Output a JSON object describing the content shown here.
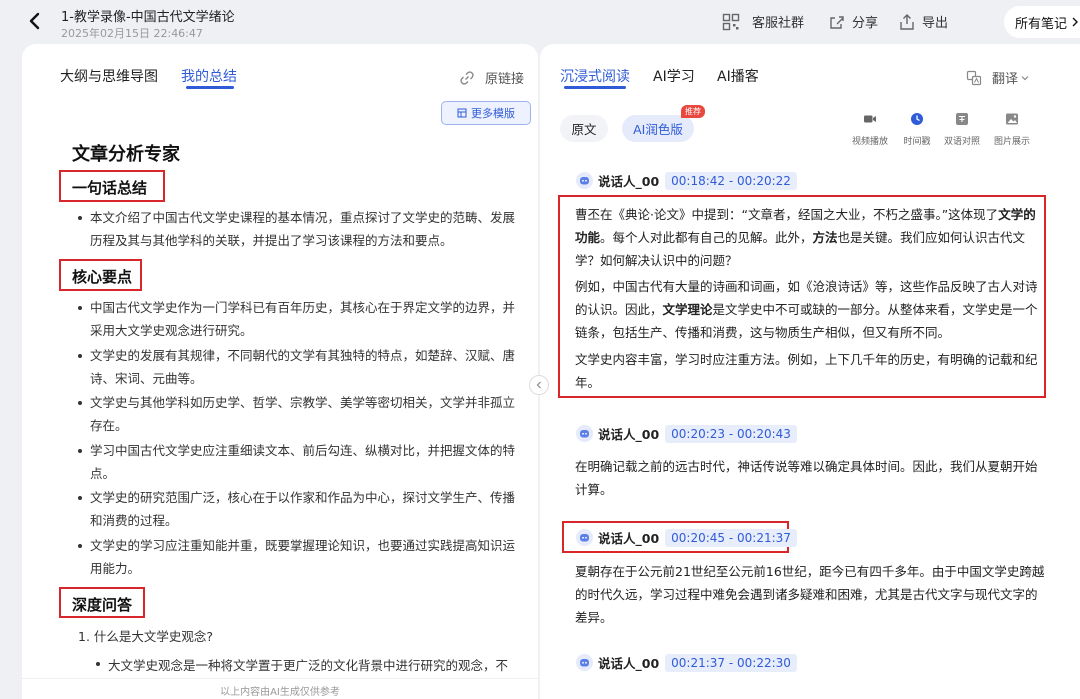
{
  "header": {
    "title": "1-教学录像-中国古代文学绪论",
    "subtitle": "2025年02月15日 22:46:47",
    "community_label": "客服社群",
    "share_label": "分享",
    "export_label": "导出",
    "all_notes_label": "所有笔记"
  },
  "left": {
    "tabs": [
      "大纲与思维导图",
      "我的总结"
    ],
    "active_tab": 1,
    "original_link_label": "原链接",
    "more_templates_label": "更多模版",
    "doc_title": "文章分析专家",
    "sections": {
      "summary": {
        "title": "一句话总结",
        "items": [
          "本文介绍了中国古代文学史课程的基本情况，重点探讨了文学史的范畴、发展历程及其与其他学科的关联，并提出了学习该课程的方法和要点。"
        ]
      },
      "key_points": {
        "title": "核心要点",
        "items": [
          "中国古代文学史作为一门学科已有百年历史，其核心在于界定文学的边界，并采用大文学史观念进行研究。",
          "文学史的发展有其规律，不同朝代的文学有其独特的特点，如楚辞、汉赋、唐诗、宋词、元曲等。",
          "文学史与其他学科如历史学、哲学、宗教学、美学等密切相关，文学并非孤立存在。",
          "学习中国古代文学史应注重细读文本、前后勾连、纵横对比，并把握文体的特点。",
          "文学史的研究范围广泛，核心在于以作家和作品为中心，探讨文学生产、传播和消费的过程。",
          "文学史的学习应注重知能并重，既要掌握理论知识，也要通过实践提高知识运用能力。"
        ]
      },
      "qa": {
        "title": "深度问答",
        "question": "1. 什么是大文学史观念?",
        "answer": "大文学史观念是一种将文学置于更广泛的文化背景中进行研究的观念，不"
      }
    },
    "disclaimer": "以上内容由AI生成仅供参考"
  },
  "right": {
    "tabs": [
      "沉浸式阅读",
      "AI学习",
      "AI播客"
    ],
    "active_tab": 0,
    "translate_label": "翻译",
    "view_original_label": "原文",
    "view_ai_label": "AI润色版",
    "recommend_badge": "推荐",
    "tools": [
      "视频播放",
      "时间戳",
      "双语对照",
      "图片展示"
    ],
    "segments": [
      {
        "speaker": "说话人_00",
        "time": "00:18:42 - 00:20:22",
        "p1": {
          "a": "曹丕在《典论·论文》中提到：“文章者，经国之大业，不朽之盛事。”这体现了",
          "b": "文学的功能",
          "c": "。每个人对此都有自己的见解。此外，",
          "d": "方法",
          "e": "也是关键。我们应如何认识古代文学？如何解决认识中的问题？"
        },
        "p2": {
          "a": "例如，中国古代有大量的诗画和词画，如《沧浪诗话》等，这些作品反映了古人对诗的认识。因此，",
          "b": "文学理论",
          "c": "是文学史中不可或缺的一部分。从整体来看，文学史是一个链条，包括生产、传播和消费，这与物质生产相似，但又有所不同。"
        },
        "p3": "文学史内容丰富，学习时应注重方法。例如，上下几千年的历史，有明确的记载和纪年。"
      },
      {
        "speaker": "说话人_00",
        "time": "00:20:23 - 00:20:43",
        "text": "在明确记载之前的远古时代，神话传说等难以确定具体时间。因此，我们从夏朝开始计算。"
      },
      {
        "speaker": "说话人_00",
        "time": "00:20:45 - 00:21:37",
        "text": "夏朝存在于公元前21世纪至公元前16世纪，距今已有四千多年。由于中国文学史跨越的时代久远，学习过程中难免会遇到诸多疑难和困难，尤其是古代文字与现代文字的差异。"
      },
      {
        "speaker": "说话人_00",
        "time": "00:21:37 - 00:22:30"
      }
    ]
  },
  "colors": {
    "accent": "#2f5bd8",
    "highlight_border": "#d9262b",
    "badge": "#e8483e"
  }
}
